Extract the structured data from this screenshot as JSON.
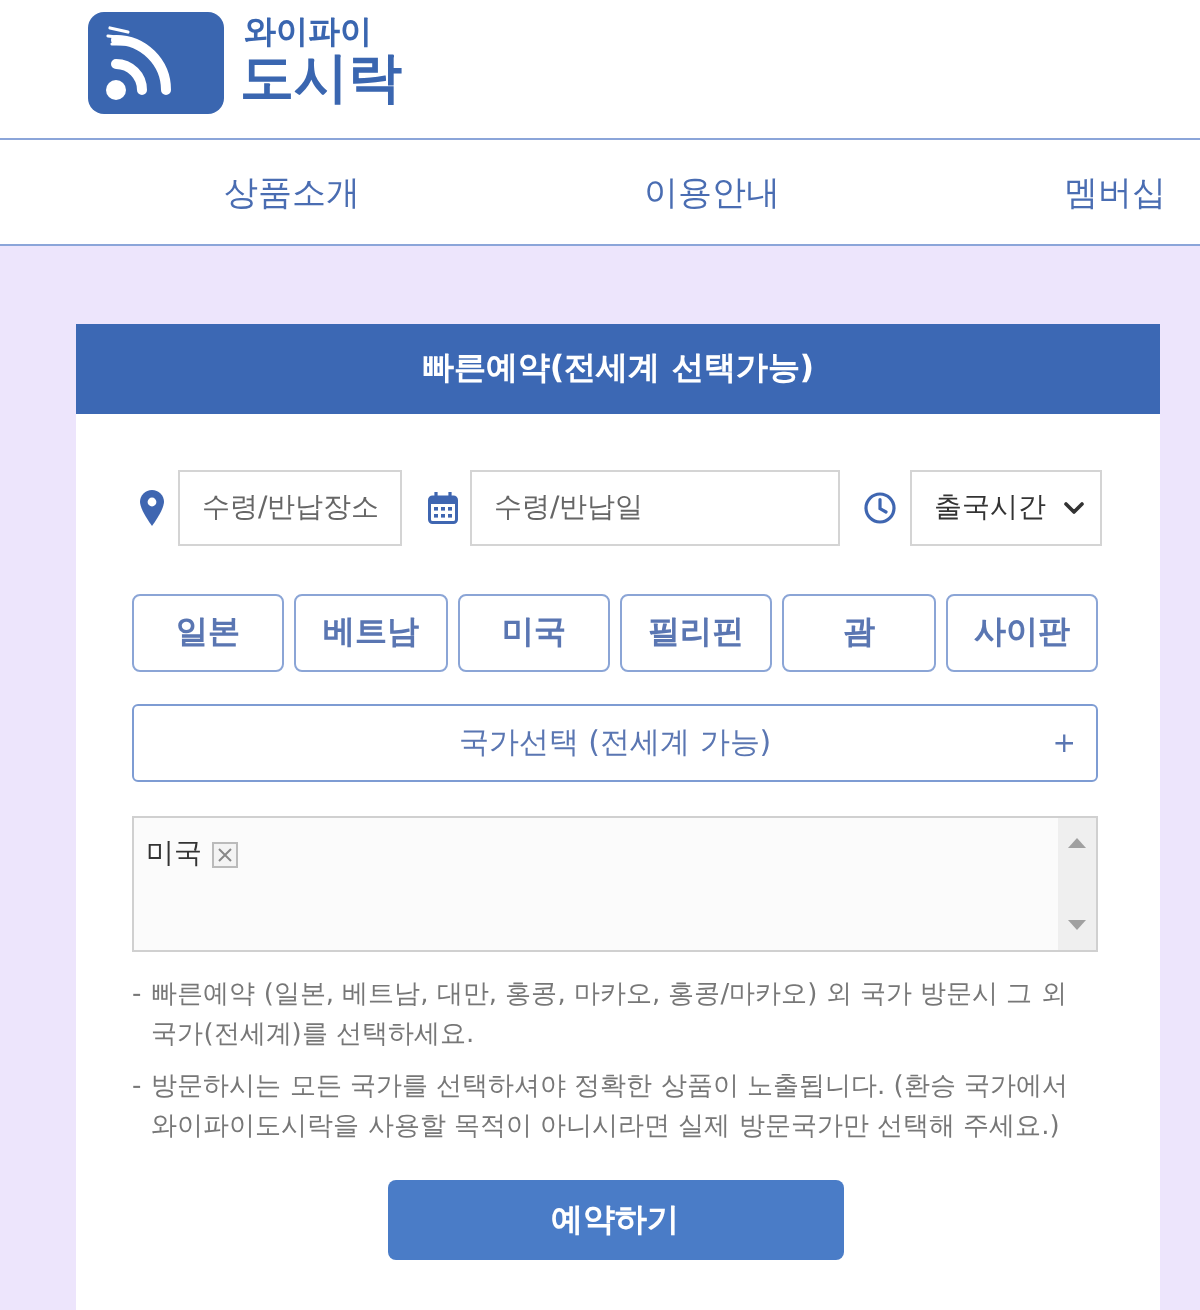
{
  "header": {
    "logo": {
      "line_1": "와이파이",
      "line_2": "도시락"
    }
  },
  "nav": {
    "items": [
      {
        "label": "상품소개"
      },
      {
        "label": "이용안내"
      },
      {
        "label": "멤버십"
      }
    ]
  },
  "booking": {
    "title": "빠른예약(전세계 선택가능)",
    "fields": [
      {
        "kind": "place",
        "placeholder": "수령/반납장소"
      },
      {
        "kind": "date",
        "placeholder": "수령/반납일"
      },
      {
        "kind": "time",
        "value": "출국시간"
      }
    ],
    "quick_countries": [
      {
        "label": "일본",
        "selected": false
      },
      {
        "label": "베트남",
        "selected": false
      },
      {
        "label": "미국",
        "selected": false
      },
      {
        "label": "필리핀",
        "selected": false
      },
      {
        "label": "괌",
        "selected": false
      },
      {
        "label": "사이판",
        "selected": false
      }
    ],
    "country_picker": {
      "label": "국가선택 (전세계 가능)",
      "symbol": "+"
    },
    "selected_countries": [
      {
        "label": "미국"
      }
    ],
    "notes": [
      {
        "bullet": "-",
        "text": "빠른예약 (일본, 베트남, 대만, 홍콩, 마카오, 홍콩/마카오) 외 국가 방문시 그 외 국가(전세계)를 선택하세요."
      },
      {
        "bullet": "-",
        "text": "방문하시는 모든 국가를 선택하셔야 정확한 상품이 노출됩니다. (환승 국가에서 와이파이도시락을 사용할 목적이 아니시라면 실제 방문국가만 선택해 주세요.)"
      }
    ],
    "submit": "예약하기"
  }
}
